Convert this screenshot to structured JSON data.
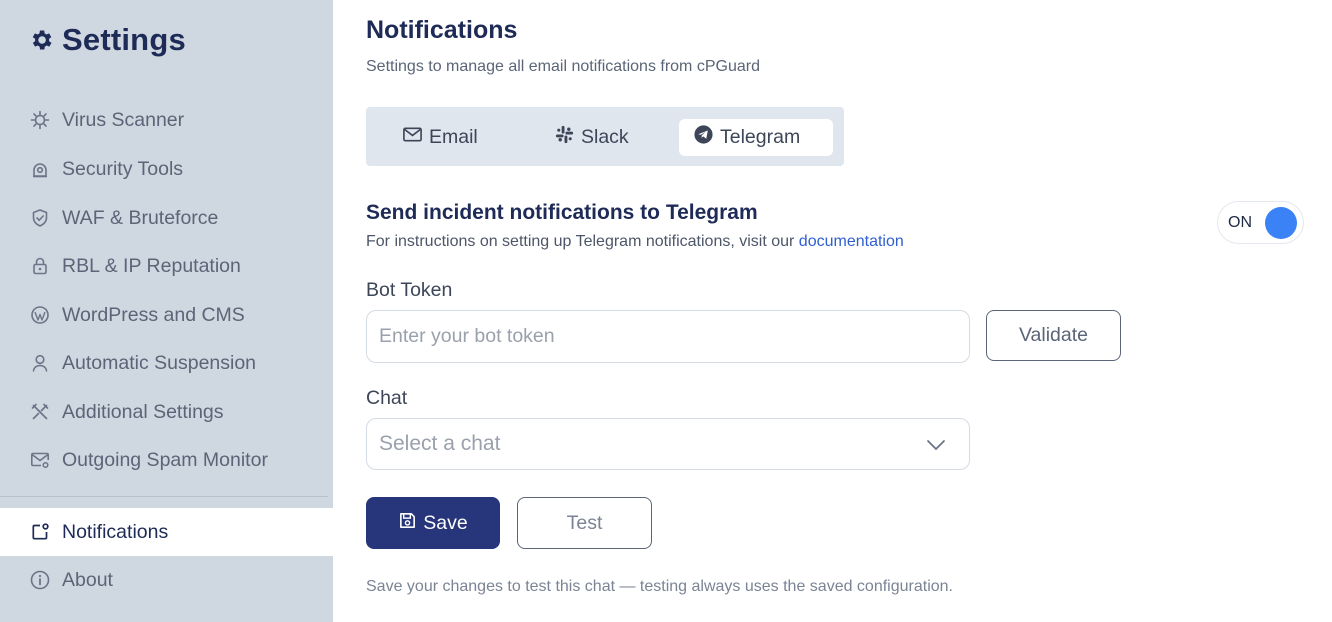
{
  "sidebar": {
    "title": "Settings",
    "title_icon": "gear-icon",
    "items": [
      {
        "label": "Virus Scanner",
        "icon": "virus-icon"
      },
      {
        "label": "Security Tools",
        "icon": "security-camera-icon"
      },
      {
        "label": "WAF & Bruteforce",
        "icon": "shield-check-icon"
      },
      {
        "label": "RBL & IP Reputation",
        "icon": "lock-icon"
      },
      {
        "label": "WordPress and CMS",
        "icon": "wordpress-icon"
      },
      {
        "label": "Automatic Suspension",
        "icon": "user-icon"
      },
      {
        "label": "Additional Settings",
        "icon": "tools-icon"
      },
      {
        "label": "Outgoing Spam Monitor",
        "icon": "mail-gear-icon"
      },
      {
        "label": "Notifications",
        "icon": "notification-icon",
        "active": true
      },
      {
        "label": "About",
        "icon": "info-icon"
      }
    ]
  },
  "main": {
    "title": "Notifications",
    "subtitle": "Settings to manage all email notifications from cPGuard",
    "tabs": [
      {
        "label": "Email",
        "icon": "mail-icon"
      },
      {
        "label": "Slack",
        "icon": "slack-icon"
      },
      {
        "label": "Telegram",
        "icon": "telegram-icon",
        "active": true
      }
    ],
    "section": {
      "title": "Send incident notifications to Telegram",
      "instructions_prefix": "For instructions on setting up Telegram notifications, visit our ",
      "instructions_link": "documentation",
      "toggle_state": "ON",
      "toggle_on": true
    },
    "bot_token": {
      "label": "Bot Token",
      "placeholder": "Enter your bot token",
      "value": "",
      "validate_label": "Validate"
    },
    "chat": {
      "label": "Chat",
      "placeholder": "Select a chat"
    },
    "save_label": "Save",
    "test_label": "Test",
    "note": "Save your changes to test this chat — testing always uses the saved configuration."
  },
  "colors": {
    "sidebar_bg": "#cfd8e0",
    "brand_navy": "#1e2b57",
    "primary_button": "#27357a",
    "toggle_knob": "#3b82f6",
    "link": "#2f5fd0"
  }
}
